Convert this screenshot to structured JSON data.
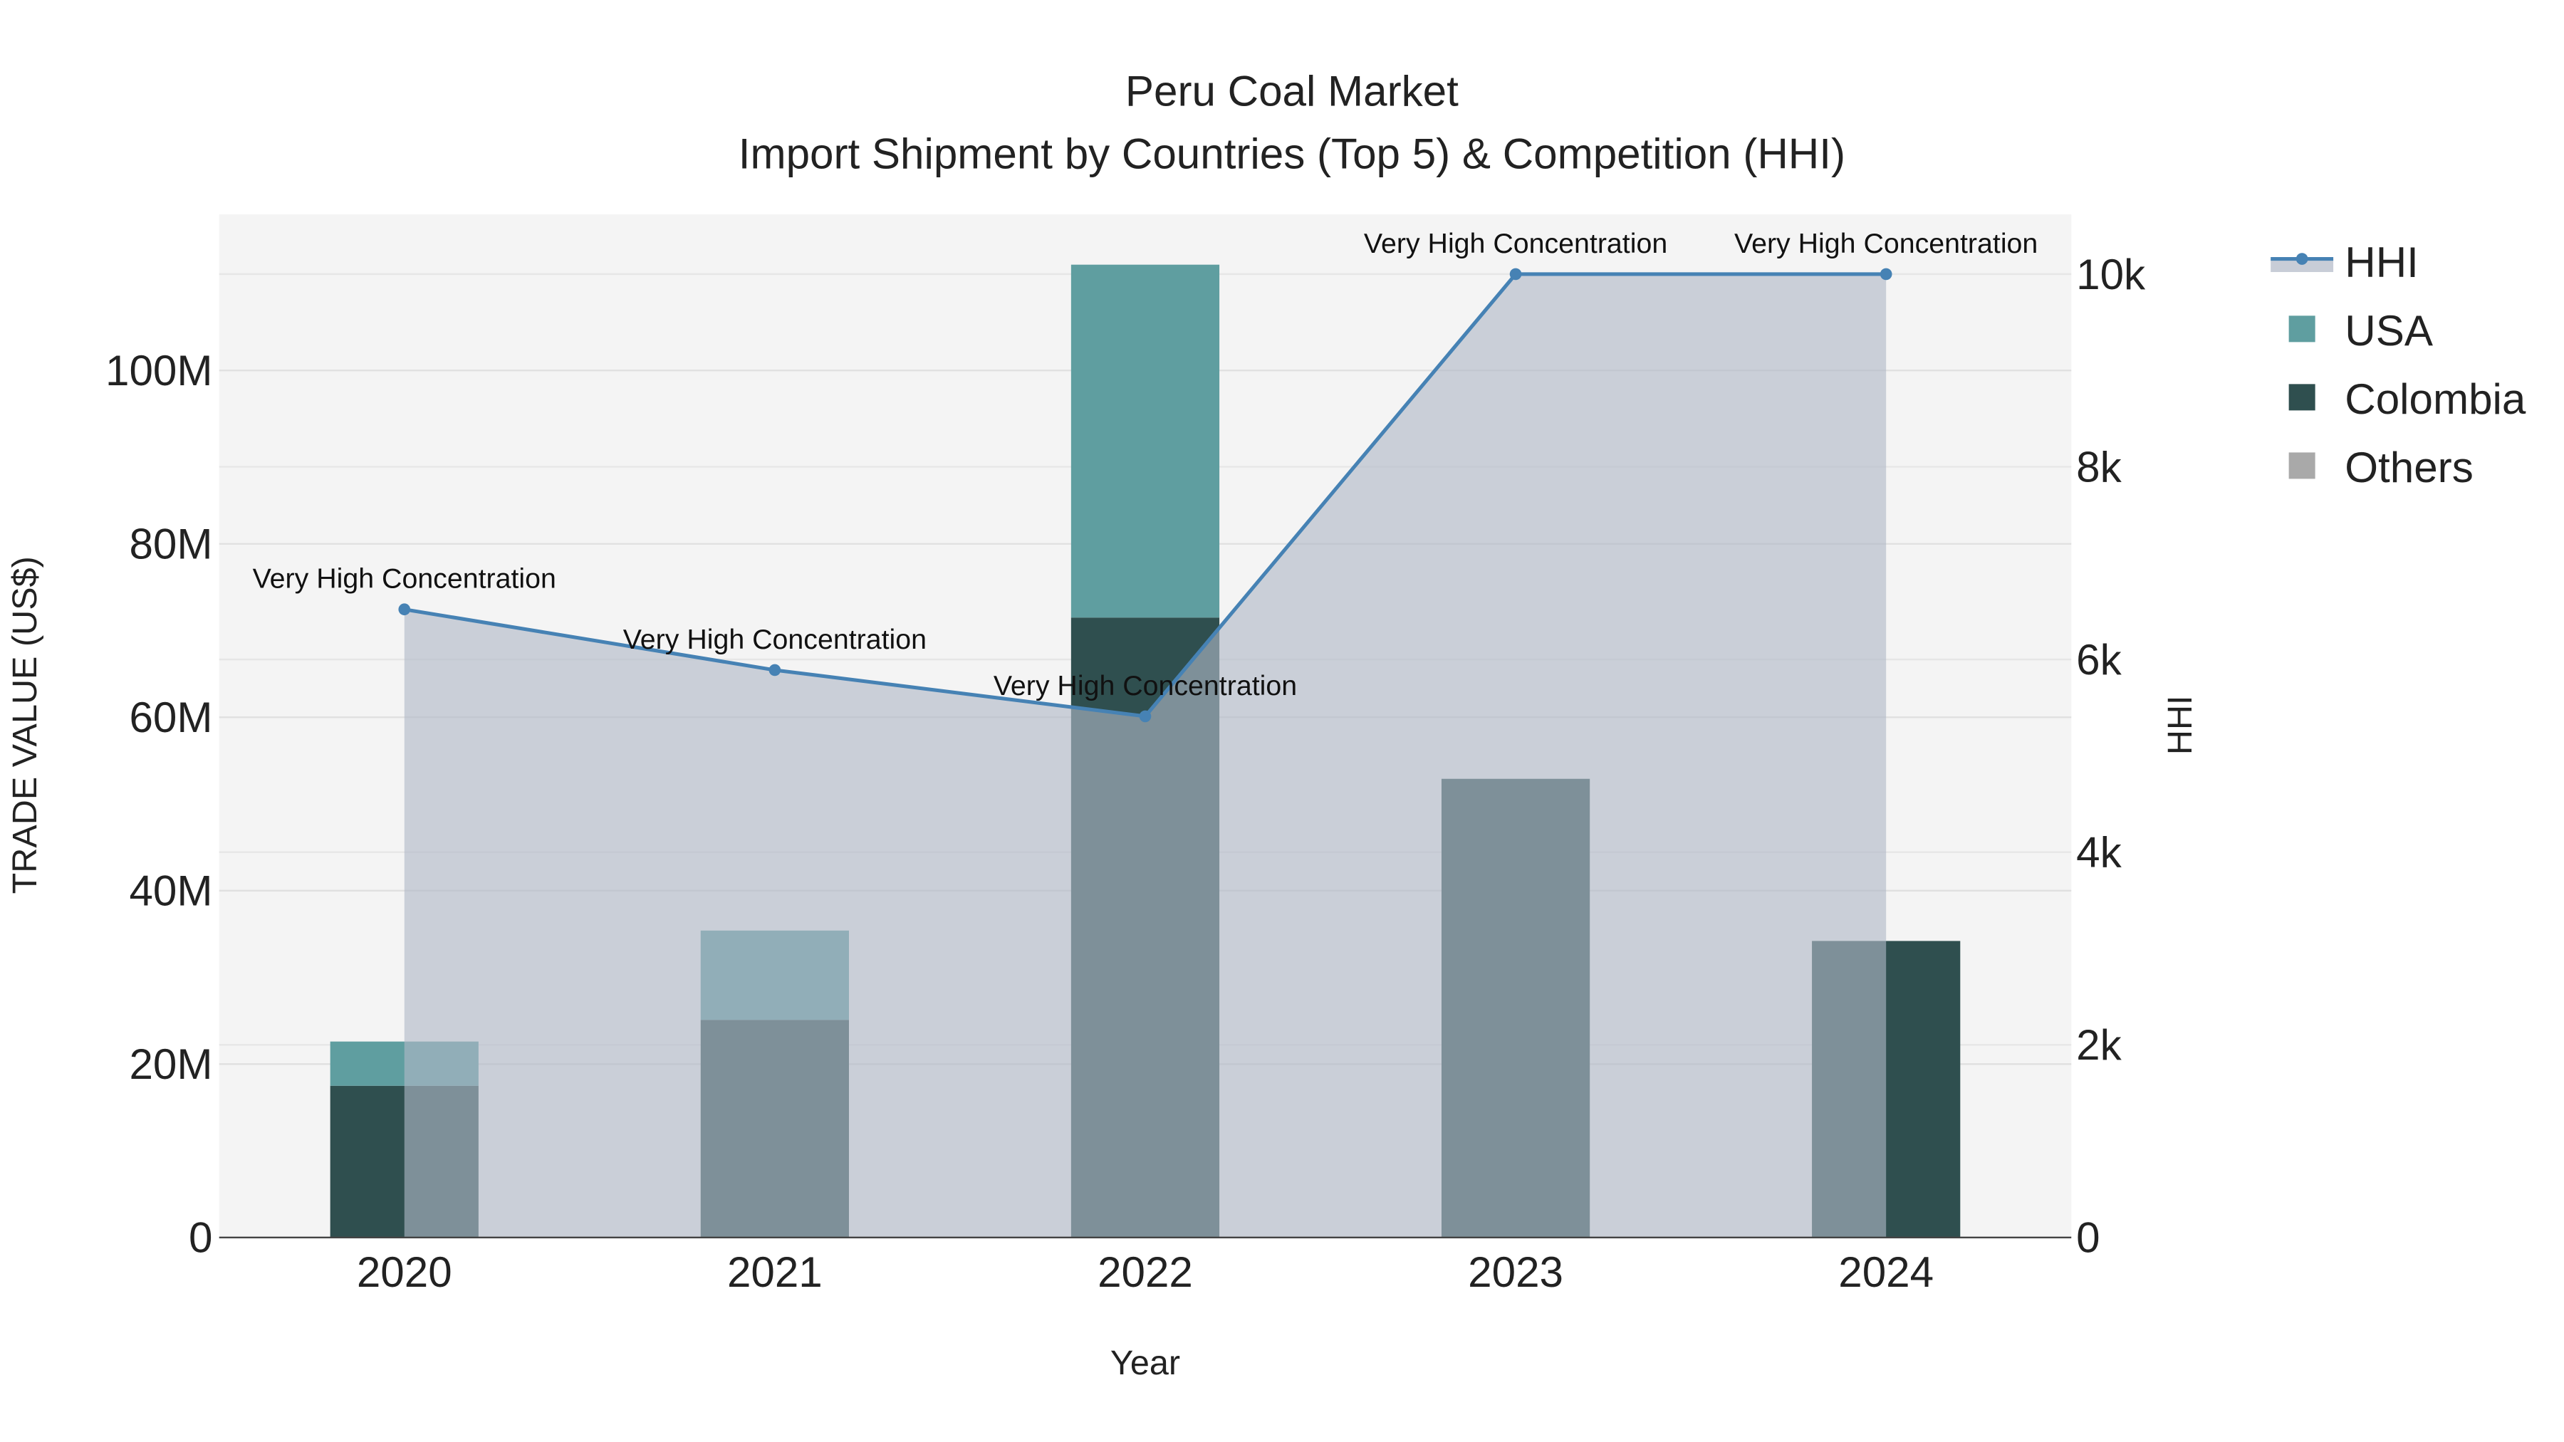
{
  "chart_data": {
    "type": "bar",
    "title": "Peru Coal Market",
    "subtitle": "Import Shipment by Countries (Top 5) & Competition (HHI)",
    "xlabel": "Year",
    "ylabel": "TRADE VALUE (US$)",
    "y2label": "HHI",
    "categories": [
      "2020",
      "2021",
      "2022",
      "2023",
      "2024"
    ],
    "ylim": [
      0,
      118000000
    ],
    "y2lim": [
      0,
      10620
    ],
    "yticks": [
      0,
      20000000,
      40000000,
      60000000,
      80000000,
      100000000
    ],
    "ytick_labels": [
      "0",
      "20M",
      "40M",
      "60M",
      "80M",
      "100M"
    ],
    "y2ticks": [
      0,
      2000,
      4000,
      6000,
      8000,
      10000
    ],
    "y2tick_labels": [
      "0",
      "2k",
      "4k",
      "6k",
      "8k",
      "10k"
    ],
    "barmode": "stack",
    "series": [
      {
        "name": "Others",
        "type": "bar",
        "color": "#a9a9a9",
        "values": [
          0,
          0,
          0,
          0,
          0
        ]
      },
      {
        "name": "Colombia",
        "type": "bar",
        "color": "#2f4f4f",
        "values": [
          17500000,
          25100000,
          71500000,
          52900000,
          34200000
        ]
      },
      {
        "name": "USA",
        "type": "bar",
        "color": "#5f9ea0",
        "values": [
          5100000,
          10300000,
          40700000,
          0,
          0
        ]
      },
      {
        "name": "HHI",
        "type": "line",
        "axis": "y2",
        "color": "#4682b4",
        "values": [
          6520,
          5890,
          5410,
          10000,
          10000
        ],
        "labels": [
          "Very High Concentration",
          "Very High Concentration",
          "Very High Concentration",
          "Very High Concentration",
          "Very High Concentration"
        ]
      }
    ],
    "legend": {
      "position": "top-right",
      "items": [
        "HHI",
        "USA",
        "Colombia",
        "Others"
      ]
    },
    "grid": true
  }
}
